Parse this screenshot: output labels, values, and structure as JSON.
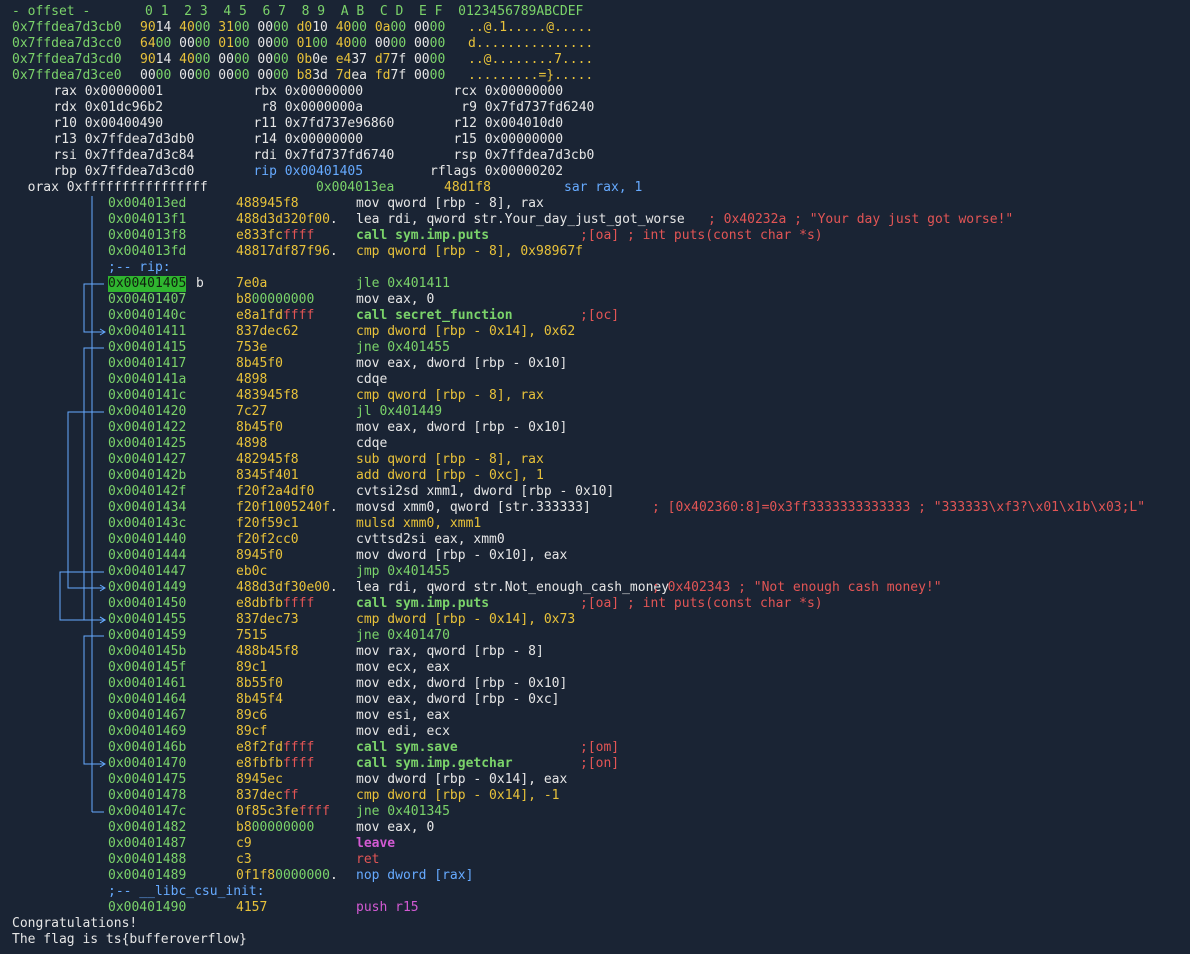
{
  "hexdump": {
    "header": "- offset -       0 1  2 3  4 5  6 7  8 9  A B  C D  E F  0123456789ABCDEF",
    "rows": [
      {
        "addr": "0x7ffdea7d3cb0",
        "hex": "9014 4000 3100 0000 d010 4000 0a00 0000",
        "ascii": "..@.1.....@....."
      },
      {
        "addr": "0x7ffdea7d3cc0",
        "hex": "6400 0000 0100 0000 0100 4000 0000 0000",
        "ascii": "d..............."
      },
      {
        "addr": "0x7ffdea7d3cd0",
        "hex": "9014 4000 0000 0000 0b0e e437 d77f 0000",
        "ascii": "..@........7...."
      },
      {
        "addr": "0x7ffdea7d3ce0",
        "hex": "0000 0000 0000 0000 b83d 7dea fd7f 0000",
        "ascii": ".........=}....."
      }
    ]
  },
  "registers": [
    [
      {
        "n": "rax",
        "v": "0x00000001"
      },
      {
        "n": "rbx",
        "v": "0x00000000"
      },
      {
        "n": "rcx",
        "v": "0x00000000"
      }
    ],
    [
      {
        "n": "rdx",
        "v": "0x01dc96b2"
      },
      {
        "n": "r8",
        "v": "0x0000000a"
      },
      {
        "n": "r9",
        "v": "0x7fd737fd6240"
      }
    ],
    [
      {
        "n": "r10",
        "v": "0x00400490"
      },
      {
        "n": "r11",
        "v": "0x7fd737e96860"
      },
      {
        "n": "r12",
        "v": "0x004010d0"
      }
    ],
    [
      {
        "n": "r13",
        "v": "0x7ffdea7d3db0"
      },
      {
        "n": "r14",
        "v": "0x00000000"
      },
      {
        "n": "r15",
        "v": "0x00000000"
      }
    ],
    [
      {
        "n": "rsi",
        "v": "0x7ffdea7d3c84"
      },
      {
        "n": "rdi",
        "v": "0x7fd737fd6740"
      },
      {
        "n": "rsp",
        "v": "0x7ffdea7d3cb0"
      }
    ],
    [
      {
        "n": "rbp",
        "v": "0x7ffdea7d3cd0"
      },
      {
        "n": "rip",
        "v": "0x00401405"
      },
      {
        "n": "rflags",
        "v": "0x00000202"
      }
    ]
  ],
  "orax": {
    "n": "orax",
    "v": "0xffffffffffffffff"
  },
  "first_instr": {
    "addr": "0x004013ea",
    "bytes": "48d1f8",
    "op": "sar rax, 1"
  },
  "disasm": [
    {
      "addr": "0x004013ed",
      "bytes": "488945f8",
      "op": "mov qword [rbp - 8], rax"
    },
    {
      "addr": "0x004013f1",
      "bytes": "488d3d320f00.",
      "op": "lea rdi, qword str.Your_day_just_got_worse",
      "cmt": "; 0x40232a ; \"Your day just got worse!\""
    },
    {
      "addr": "0x004013f8",
      "bytes": "e833fcffff",
      "op": "call sym.imp.puts",
      "cmt": ";[oa] ; int puts(const char *s)"
    },
    {
      "addr": "0x004013fd",
      "bytes": "48817df87f96.",
      "op": "cmp qword [rbp - 8], 0x98967f"
    },
    {
      "label": ";-- rip:"
    },
    {
      "addr": "0x00401405",
      "bytes": "7e0a",
      "op": "jle 0x401411",
      "mark": "b"
    },
    {
      "addr": "0x00401407",
      "bytes": "b800000000",
      "op": "mov eax, 0"
    },
    {
      "addr": "0x0040140c",
      "bytes": "e8a1fdffff",
      "op": "call secret_function",
      "cmt": ";[oc]"
    },
    {
      "addr": "0x00401411",
      "bytes": "837dec62",
      "op": "cmp dword [rbp - 0x14], 0x62"
    },
    {
      "addr": "0x00401415",
      "bytes": "753e",
      "op": "jne 0x401455"
    },
    {
      "addr": "0x00401417",
      "bytes": "8b45f0",
      "op": "mov eax, dword [rbp - 0x10]"
    },
    {
      "addr": "0x0040141a",
      "bytes": "4898",
      "op": "cdqe"
    },
    {
      "addr": "0x0040141c",
      "bytes": "483945f8",
      "op": "cmp qword [rbp - 8], rax"
    },
    {
      "addr": "0x00401420",
      "bytes": "7c27",
      "op": "jl 0x401449"
    },
    {
      "addr": "0x00401422",
      "bytes": "8b45f0",
      "op": "mov eax, dword [rbp - 0x10]"
    },
    {
      "addr": "0x00401425",
      "bytes": "4898",
      "op": "cdqe"
    },
    {
      "addr": "0x00401427",
      "bytes": "482945f8",
      "op": "sub qword [rbp - 8], rax"
    },
    {
      "addr": "0x0040142b",
      "bytes": "8345f401",
      "op": "add dword [rbp - 0xc], 1"
    },
    {
      "addr": "0x0040142f",
      "bytes": "f20f2a4df0",
      "op": "cvtsi2sd xmm1, dword [rbp - 0x10]"
    },
    {
      "addr": "0x00401434",
      "bytes": "f20f1005240f.",
      "op": "movsd xmm0, qword [str.333333]",
      "cmt": "; [0x402360:8]=0x3ff3333333333333 ; \"333333\\xf3?\\x01\\x1b\\x03;L\""
    },
    {
      "addr": "0x0040143c",
      "bytes": "f20f59c1",
      "op": "mulsd xmm0, xmm1"
    },
    {
      "addr": "0x00401440",
      "bytes": "f20f2cc0",
      "op": "cvttsd2si eax, xmm0"
    },
    {
      "addr": "0x00401444",
      "bytes": "8945f0",
      "op": "mov dword [rbp - 0x10], eax"
    },
    {
      "addr": "0x00401447",
      "bytes": "eb0c",
      "op": "jmp 0x401455"
    },
    {
      "addr": "0x00401449",
      "bytes": "488d3df30e00.",
      "op": "lea rdi, qword str.Not_enough_cash_money",
      "cmt": "; 0x402343 ; \"Not enough cash money!\""
    },
    {
      "addr": "0x00401450",
      "bytes": "e8dbfbffff",
      "op": "call sym.imp.puts",
      "cmt": ";[oa] ; int puts(const char *s)"
    },
    {
      "addr": "0x00401455",
      "bytes": "837dec73",
      "op": "cmp dword [rbp - 0x14], 0x73"
    },
    {
      "addr": "0x00401459",
      "bytes": "7515",
      "op": "jne 0x401470"
    },
    {
      "addr": "0x0040145b",
      "bytes": "488b45f8",
      "op": "mov rax, qword [rbp - 8]"
    },
    {
      "addr": "0x0040145f",
      "bytes": "89c1",
      "op": "mov ecx, eax"
    },
    {
      "addr": "0x00401461",
      "bytes": "8b55f0",
      "op": "mov edx, dword [rbp - 0x10]"
    },
    {
      "addr": "0x00401464",
      "bytes": "8b45f4",
      "op": "mov eax, dword [rbp - 0xc]"
    },
    {
      "addr": "0x00401467",
      "bytes": "89c6",
      "op": "mov esi, eax"
    },
    {
      "addr": "0x00401469",
      "bytes": "89cf",
      "op": "mov edi, ecx"
    },
    {
      "addr": "0x0040146b",
      "bytes": "e8f2fdffff",
      "op": "call sym.save",
      "cmt": ";[om]"
    },
    {
      "addr": "0x00401470",
      "bytes": "e8fbfbffff",
      "op": "call sym.imp.getchar",
      "cmt": ";[on]"
    },
    {
      "addr": "0x00401475",
      "bytes": "8945ec",
      "op": "mov dword [rbp - 0x14], eax"
    },
    {
      "addr": "0x00401478",
      "bytes": "837decff",
      "op": "cmp dword [rbp - 0x14], -1"
    },
    {
      "addr": "0x0040147c",
      "bytes": "0f85c3feffff",
      "op": "jne 0x401345"
    },
    {
      "addr": "0x00401482",
      "bytes": "b800000000",
      "op": "mov eax, 0"
    },
    {
      "addr": "0x00401487",
      "bytes": "c9",
      "op": "leave"
    },
    {
      "addr": "0x00401488",
      "bytes": "c3",
      "op": "ret"
    },
    {
      "addr": "0x00401489",
      "bytes": "0f1f80000000.",
      "op": "nop dword [rax]"
    },
    {
      "label": ";-- __libc_csu_init:"
    },
    {
      "addr": "0x00401490",
      "bytes": "4157",
      "op": "push r15"
    }
  ],
  "output": [
    "Congratulations!",
    "The flag is ts{bufferoverflow}"
  ],
  "colors": {
    "bg": "#1a2434",
    "green": "#7bd36a",
    "yellow": "#e8c23a",
    "blue": "#66aaff",
    "red": "#e25555",
    "magenta": "#d35ad3"
  }
}
